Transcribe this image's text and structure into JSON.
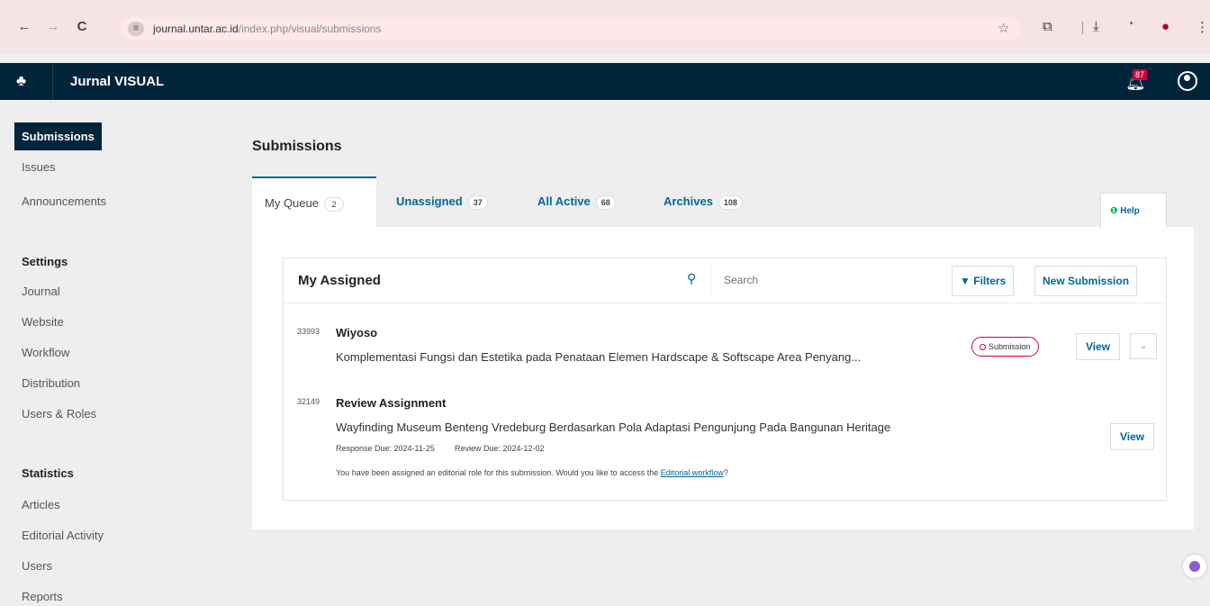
{
  "browser": {
    "url_host": "journal.untar.ac.id",
    "url_path": "/index.php/visual/submissions",
    "back": "←",
    "forward": "→",
    "reload": "C"
  },
  "header": {
    "app_title": "Jurnal VISUAL",
    "notification_count": "87"
  },
  "sidebar": {
    "items": [
      "Submissions",
      "Issues",
      "Announcements"
    ],
    "settings_heading": "Settings",
    "settings_items": [
      "Journal",
      "Website",
      "Workflow",
      "Distribution",
      "Users & Roles"
    ],
    "statistics_heading": "Statistics",
    "statistics_items": [
      "Articles",
      "Editorial Activity",
      "Users",
      "Reports"
    ]
  },
  "main": {
    "title": "Submissions",
    "tabs": [
      {
        "label": "My Queue",
        "count": "2"
      },
      {
        "label": "Unassigned",
        "count": "37"
      },
      {
        "label": "All Active",
        "count": "68"
      },
      {
        "label": "Archives",
        "count": "108"
      }
    ],
    "help_label": "Help"
  },
  "list": {
    "title": "My Assigned",
    "search_placeholder": "Search",
    "filters_label": "Filters",
    "new_submission_label": "New Submission",
    "items": [
      {
        "id": "33993",
        "author": "Wiyoso",
        "title": "Komplementasi Fungsi dan Estetika pada Penataan Elemen Hardscape & Softscape Area Penyang...",
        "stage": "Submission",
        "view_label": "View"
      },
      {
        "id": "32149",
        "author": "Review Assignment",
        "title": "Wayfinding Museum Benteng Vredeburg Berdasarkan Pola Adaptasi Pengunjung Pada Bangunan Heritage",
        "response_due": "Response Due: 2024-11-25",
        "review_due": "Review Due: 2024-12-02",
        "note": "You have been assigned an editorial role for this submission. Would you like to access the",
        "note_link": "Editorial workflow",
        "note_end": "?",
        "view_label": "View"
      }
    ]
  },
  "colors": {
    "header_bg": "#00243a",
    "link": "#006798",
    "badge_red": "#d0003c"
  }
}
